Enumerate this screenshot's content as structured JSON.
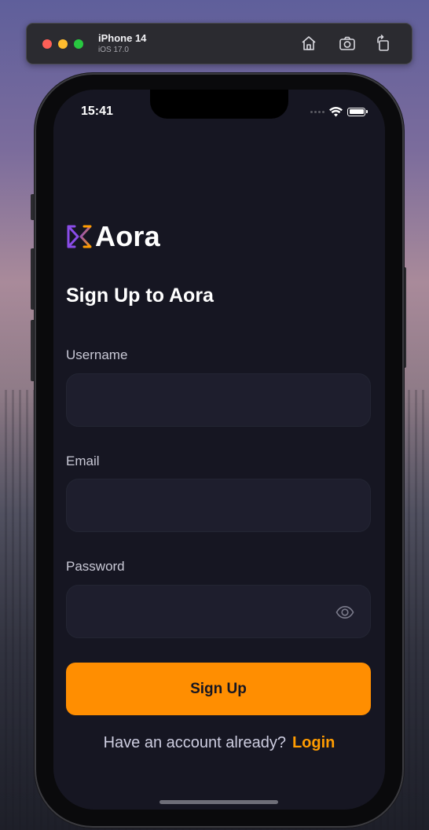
{
  "simulator": {
    "device_name": "iPhone 14",
    "os_version": "iOS 17.0",
    "icons": [
      "home-icon",
      "screenshot-icon",
      "rotate-icon"
    ]
  },
  "status_bar": {
    "time": "15:41"
  },
  "app": {
    "logo_text": "Aora",
    "heading": "Sign Up to Aora"
  },
  "form": {
    "username_label": "Username",
    "username_value": "",
    "email_label": "Email",
    "email_value": "",
    "password_label": "Password",
    "password_value": "",
    "password_toggle_icon": "eye-icon",
    "submit_label": "Sign Up"
  },
  "footer": {
    "question": "Have an account already?",
    "link_label": "Login"
  },
  "colors": {
    "background": "#161622",
    "field_bg": "#1e1e2d",
    "accent": "#ff8e01",
    "link": "#ff9c01",
    "logo_gradient": [
      "#7b3fe4",
      "#ff9c01"
    ]
  }
}
